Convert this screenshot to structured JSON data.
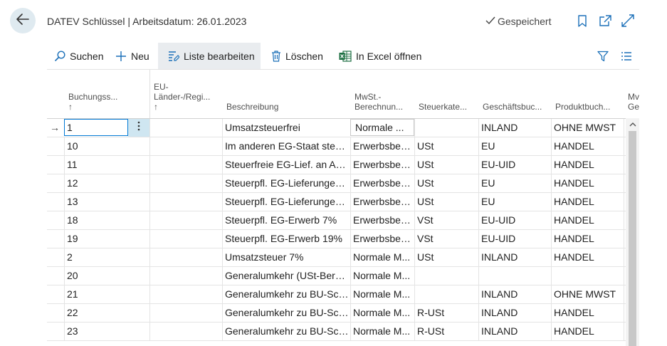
{
  "header": {
    "title": "DATEV Schlüssel | Arbeitsdatum: 26.01.2023",
    "saved_label": "Gespeichert"
  },
  "icons": {
    "back": "arrow-left-icon",
    "saved": "checkmark-icon",
    "bookmark": "bookmark-icon",
    "open_new": "open-in-new-window-icon",
    "expand": "expand-icon",
    "search": "search-icon",
    "new": "plus-icon",
    "edit_list": "edit-list-icon",
    "delete": "trash-icon",
    "excel": "excel-icon",
    "filter": "filter-icon",
    "list_view": "list-view-icon"
  },
  "toolbar": {
    "search_label": "Suchen",
    "new_label": "Neu",
    "edit_list_label": "Liste bearbeiten",
    "delete_label": "Löschen",
    "excel_label": "In Excel öffnen"
  },
  "columns": {
    "buchungsschluessel": "Buchungss...",
    "eu_laender": "EU-\nLänder-/Regi...",
    "beschreibung": "Beschreibung",
    "mwst": "MwSt.-\nBerechnun...",
    "steuerkat": "Steuerkate...",
    "geschaeftsbuch": "Geschäftsbuc...",
    "produktbuch": "Produktbuch...",
    "more": "Mv\nGe",
    "sort_arrow": "↑"
  },
  "rows": [
    {
      "key": "1",
      "desc": "Umsatzsteuerfrei",
      "mwst": "Normale ...",
      "steuer": "",
      "gesch": "INLAND",
      "prod": "OHNE MWST"
    },
    {
      "key": "10",
      "desc": "Im anderen EG-Staat steue...",
      "mwst": "Erwerbsbest...",
      "steuer": "USt",
      "gesch": "EU",
      "prod": "HANDEL"
    },
    {
      "key": "11",
      "desc": "Steuerfreie EG-Lief. an Abn...",
      "mwst": "Erwerbsbest...",
      "steuer": "USt",
      "gesch": "EU-UID",
      "prod": "HANDEL"
    },
    {
      "key": "12",
      "desc": "Steuerpfl. EG-Lieferungen ...",
      "mwst": "Erwerbsbest...",
      "steuer": "USt",
      "gesch": "EU",
      "prod": "HANDEL"
    },
    {
      "key": "13",
      "desc": "Steuerpfl. EG-Lieferungen ...",
      "mwst": "Erwerbsbest...",
      "steuer": "USt",
      "gesch": "EU",
      "prod": "HANDEL"
    },
    {
      "key": "18",
      "desc": "Steuerpfl. EG-Erwerb 7%",
      "mwst": "Erwerbsbest...",
      "steuer": "VSt",
      "gesch": "EU-UID",
      "prod": "HANDEL"
    },
    {
      "key": "19",
      "desc": "Steuerpfl. EG-Erwerb 19%",
      "mwst": "Erwerbsbest...",
      "steuer": "VSt",
      "gesch": "EU-UID",
      "prod": "HANDEL"
    },
    {
      "key": "2",
      "desc": "Umsatzsteuer 7%",
      "mwst": "Normale M...",
      "steuer": "USt",
      "gesch": "INLAND",
      "prod": "HANDEL"
    },
    {
      "key": "20",
      "desc": "Generalumkehr (USt-Berec...",
      "mwst": "Normale M...",
      "steuer": "",
      "gesch": "",
      "prod": ""
    },
    {
      "key": "21",
      "desc": "Generalumkehr zu BU-Schl...",
      "mwst": "Normale M...",
      "steuer": "",
      "gesch": "INLAND",
      "prod": "OHNE MWST"
    },
    {
      "key": "22",
      "desc": "Generalumkehr zu BU-Schl...",
      "mwst": "Normale M...",
      "steuer": "R-USt",
      "gesch": "INLAND",
      "prod": "HANDEL"
    },
    {
      "key": "23",
      "desc": "Generalumkehr zu BU-Schl...",
      "mwst": "Normale M...",
      "steuer": "R-USt",
      "gesch": "INLAND",
      "prod": "HANDEL"
    }
  ],
  "selected_row_marker": "→",
  "colors": {
    "accent": "#0078d4",
    "back_button_bg": "#dfeaf0",
    "active_toolbar_bg": "#e9ecef",
    "dots_bg": "#cfe6f1",
    "icon_blue": "#1a6fb8",
    "excel_green": "#1d6f42"
  }
}
